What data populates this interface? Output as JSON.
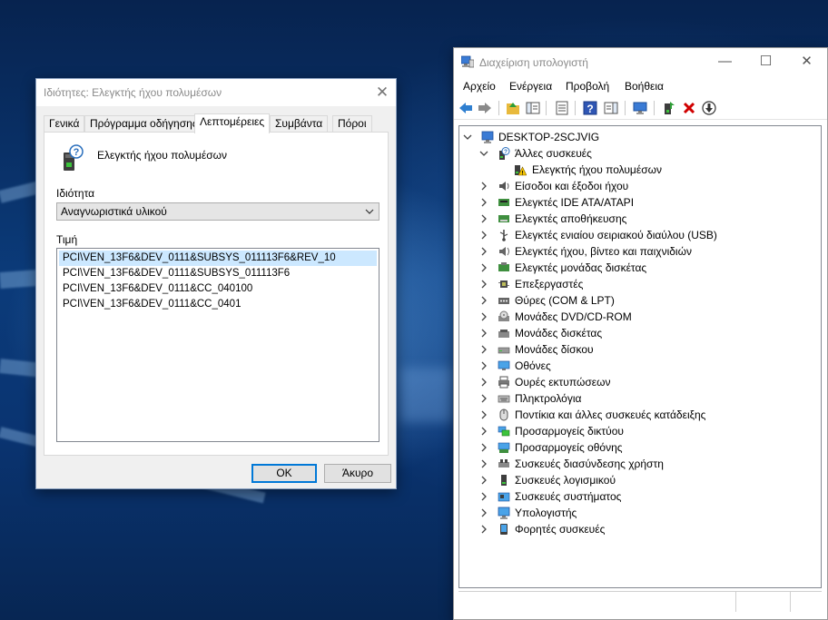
{
  "dialog": {
    "title": "Ιδιότητες: Ελεγκτής ήχου πολυμέσων",
    "close_glyph": "✕",
    "tabs": [
      "Γενικά",
      "Πρόγραμμα οδήγησης",
      "Λεπτομέρειες",
      "Συμβάντα",
      "Πόροι"
    ],
    "active_tab": "Λεπτομέρειες",
    "device_name": "Ελεγκτής ήχου πολυμέσων",
    "property_label": "Ιδιότητα",
    "property_value": "Αναγνωριστικά υλικού",
    "value_label": "Τιμή",
    "values": [
      "PCI\\VEN_13F6&DEV_0111&SUBSYS_011113F6&REV_10",
      "PCI\\VEN_13F6&DEV_0111&SUBSYS_011113F6",
      "PCI\\VEN_13F6&DEV_0111&CC_040100",
      "PCI\\VEN_13F6&DEV_0111&CC_0401"
    ],
    "ok_label": "OK",
    "cancel_label": "Άκυρο"
  },
  "mgmt": {
    "title": "Διαχείριση υπολογιστή",
    "window_buttons": {
      "minimize": "—",
      "maximize": "☐",
      "close": "✕"
    },
    "menu": [
      "Αρχείο",
      "Ενέργεια",
      "Προβολή",
      "Βοήθεια"
    ],
    "tree": {
      "root": "DESKTOP-2SCJVIG",
      "other_devices": "Άλλες συσκευές",
      "other_child": "Ελεγκτής ήχου πολυμέσων",
      "categories": [
        "Είσοδοι και έξοδοι ήχου",
        "Ελεγκτές IDE ATA/ATAPI",
        "Ελεγκτές αποθήκευσης",
        "Ελεγκτές ενιαίου σειριακού διαύλου (USB)",
        "Ελεγκτές ήχου, βίντεο και παιχνιδιών",
        "Ελεγκτές μονάδας δισκέτας",
        "Επεξεργαστές",
        "Θύρες (COM & LPT)",
        "Μονάδες DVD/CD-ROM",
        "Μονάδες δισκέτας",
        "Μονάδες δίσκου",
        "Οθόνες",
        "Ουρές εκτυπώσεων",
        "Πληκτρολόγια",
        "Ποντίκια και άλλες συσκευές κατάδειξης",
        "Προσαρμογείς δικτύου",
        "Προσαρμογείς οθόνης",
        "Συσκευές διασύνδεσης χρήστη",
        "Συσκευές λογισμικού",
        "Συσκευές συστήματος",
        "Υπολογιστής",
        "Φορητές συσκευές"
      ]
    }
  },
  "colors": {
    "selection": "#cce8ff",
    "accent": "#0078d7",
    "warning": "#f2c200",
    "error_red": "#d00000"
  }
}
